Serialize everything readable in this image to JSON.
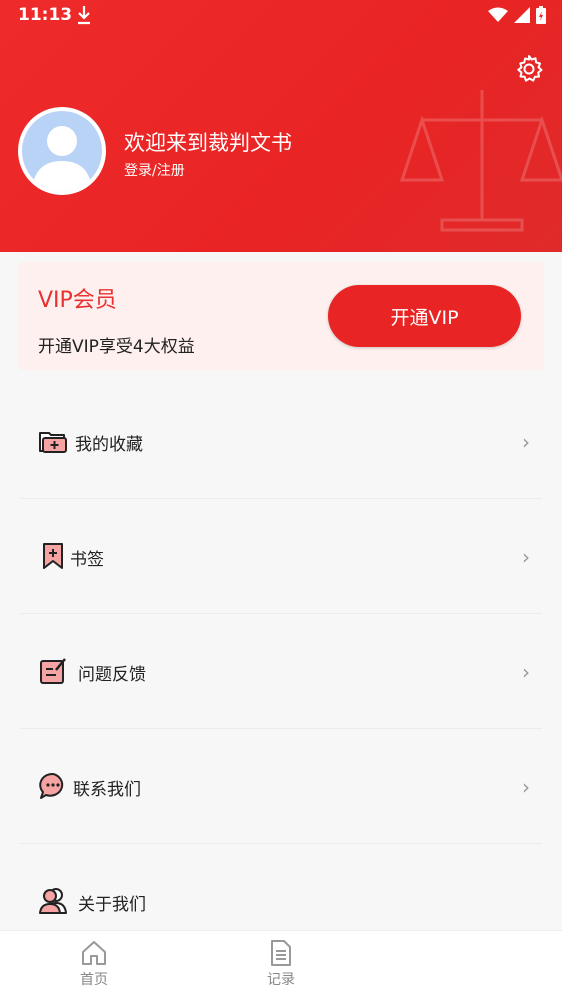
{
  "status": {
    "time": "11:13"
  },
  "profile": {
    "welcome": "欢迎来到裁判文书",
    "login": "登录/注册"
  },
  "vip": {
    "title": "VIP会员",
    "subtitle": "开通VIP享受4大权益",
    "button": "开通VIP"
  },
  "menu": [
    {
      "label": "我的收藏",
      "icon": "folder-icon"
    },
    {
      "label": "书签",
      "icon": "bookmark-icon"
    },
    {
      "label": "问题反馈",
      "icon": "feedback-icon"
    },
    {
      "label": "联系我们",
      "icon": "chat-icon"
    },
    {
      "label": "关于我们",
      "icon": "users-icon"
    }
  ],
  "tabs": [
    {
      "label": "首页",
      "icon": "home-icon"
    },
    {
      "label": "记录",
      "icon": "document-icon"
    }
  ],
  "colors": {
    "brand": "#e82424",
    "vip_bg": "#fdf0ef"
  }
}
